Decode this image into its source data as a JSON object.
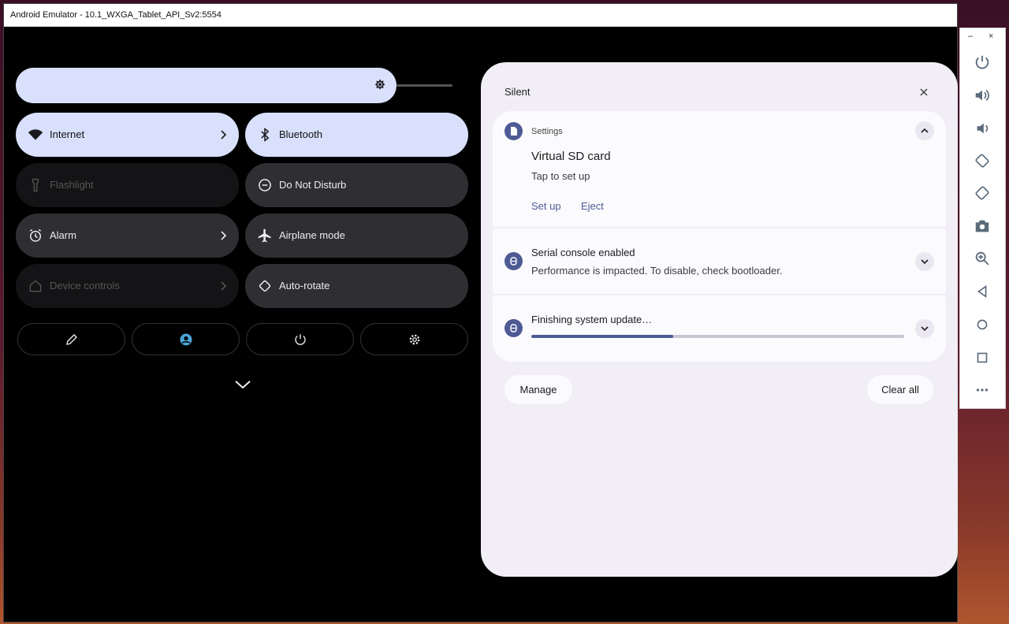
{
  "window": {
    "title": "Android Emulator - 10.1_WXGA_Tablet_API_Sv2:5554"
  },
  "quick_settings": {
    "tiles": [
      {
        "label": "Internet",
        "state": "on",
        "icon": "wifi-icon",
        "has_chevron": true
      },
      {
        "label": "Bluetooth",
        "state": "on",
        "icon": "bluetooth-icon",
        "has_chevron": false
      },
      {
        "label": "Flashlight",
        "state": "unavailable",
        "icon": "flashlight-icon",
        "has_chevron": false
      },
      {
        "label": "Do Not Disturb",
        "state": "off",
        "icon": "do-not-disturb-icon",
        "has_chevron": false
      },
      {
        "label": "Alarm",
        "state": "off",
        "icon": "alarm-icon",
        "has_chevron": true
      },
      {
        "label": "Airplane mode",
        "state": "off",
        "icon": "airplane-icon",
        "has_chevron": false
      },
      {
        "label": "Device controls",
        "state": "unavailable",
        "icon": "home-icon",
        "has_chevron": true
      },
      {
        "label": "Auto-rotate",
        "state": "off",
        "icon": "auto-rotate-icon",
        "has_chevron": false
      }
    ],
    "buttons": [
      "edit-icon",
      "user-icon",
      "power-icon",
      "settings-icon"
    ]
  },
  "notifications": {
    "header": "Silent",
    "items": [
      {
        "app": "Settings",
        "title": "Virtual SD card",
        "text": "Tap to set up",
        "actions": [
          "Set up",
          "Eject"
        ],
        "expanded": true
      },
      {
        "title": "Serial console enabled",
        "text": "Performance is impacted. To disable, check bootloader."
      },
      {
        "title": "Finishing system update…",
        "progress": 0.38
      }
    ],
    "manage_label": "Manage",
    "clear_all_label": "Clear all"
  },
  "toolbar": {
    "minimize": "–",
    "close": "×",
    "buttons": [
      "power-icon",
      "volume-up-icon",
      "volume-down-icon",
      "rotate-left-icon",
      "rotate-right-icon",
      "camera-icon",
      "zoom-icon",
      "back-icon",
      "home-icon",
      "overview-icon",
      "more-icon"
    ]
  },
  "colors": {
    "tile_on": "#d8e0fb",
    "tile_off": "#2f2f33",
    "accent": "#4e5a94",
    "panel": "#f1eef5"
  }
}
